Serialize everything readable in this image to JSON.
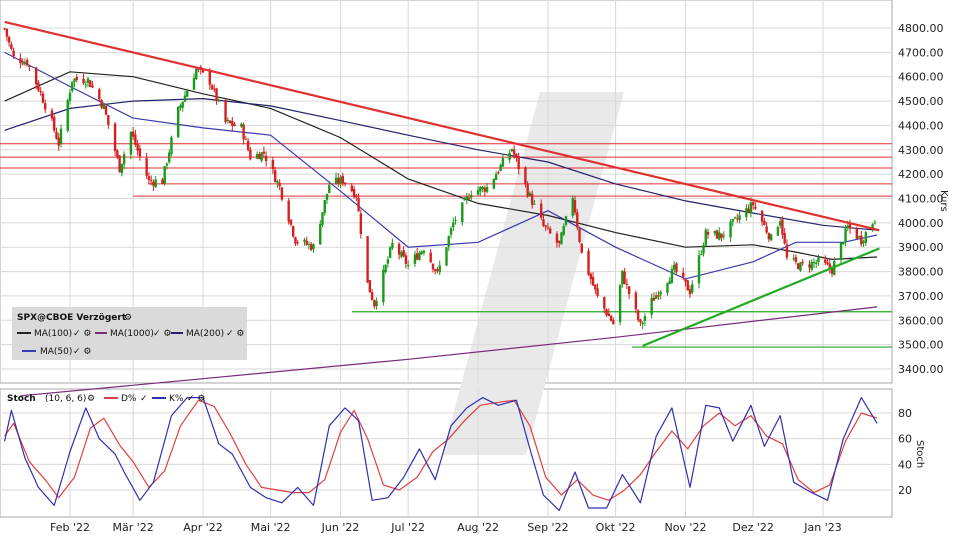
{
  "colors": {
    "candle_up": "#1a9a1a",
    "candle_down": "#d42020",
    "resistance": "#e03030",
    "support": "#22aa22",
    "ma100": "#222222",
    "ma1000": "#7a2a7a",
    "ma200": "#22226e",
    "ma50": "#3a3ab0",
    "stoch_d": "#e04040",
    "stoch_k": "#3030b0",
    "grid": "#d8d8d8"
  },
  "main_panel": {
    "axis_title": "Kurs",
    "legend": {
      "title": "SPX@CBOE Verzögert",
      "items": [
        {
          "label": "MA(100)",
          "color": "#222222"
        },
        {
          "label": "MA(1000)",
          "color": "#7a2a7a"
        },
        {
          "label": "MA(200)",
          "color": "#22226e"
        },
        {
          "label": "MA(50)",
          "color": "#3a3ab0"
        }
      ]
    }
  },
  "stoch_panel": {
    "axis_title": "Stoch",
    "legend": {
      "title": "Stoch",
      "params": "(10, 6, 6)",
      "d_label": "D%",
      "k_label": "K%"
    }
  },
  "chart_data": [
    {
      "type": "candlestick",
      "ylim": [
        3330,
        4900
      ],
      "yticks": [
        "3400.00",
        "3500.00",
        "3600.00",
        "3700.00",
        "3800.00",
        "3900.00",
        "4000.00",
        "4100.00",
        "4200.00",
        "4300.00",
        "4400.00",
        "4500.00",
        "4600.00",
        "4700.00",
        "4800.00"
      ],
      "xticks": [
        "Feb '22",
        "Mär '22",
        "Apr '22",
        "Mai '22",
        "Jun '22",
        "Jul '22",
        "Aug '22",
        "Sep '22",
        "Okt '22",
        "Nov '22",
        "Dez '22",
        "Jan '23"
      ],
      "ylabel": "Kurs",
      "grid": true,
      "close_path": [
        [
          "2022-01-03",
          4797
        ],
        [
          "2022-01-07",
          4677
        ],
        [
          "2022-01-13",
          4660
        ],
        [
          "2022-01-19",
          4532
        ],
        [
          "2022-01-24",
          4410
        ],
        [
          "2022-01-27",
          4326
        ],
        [
          "2022-02-02",
          4589
        ],
        [
          "2022-02-09",
          4587
        ],
        [
          "2022-02-16",
          4475
        ],
        [
          "2022-02-23",
          4225
        ],
        [
          "2022-02-28",
          4373
        ],
        [
          "2022-03-08",
          4170
        ],
        [
          "2022-03-14",
          4173
        ],
        [
          "2022-03-21",
          4461
        ],
        [
          "2022-03-29",
          4631
        ],
        [
          "2022-04-04",
          4582
        ],
        [
          "2022-04-11",
          4412
        ],
        [
          "2022-04-18",
          4391
        ],
        [
          "2022-04-22",
          4271
        ],
        [
          "2022-04-28",
          4287
        ],
        [
          "2022-05-05",
          4146
        ],
        [
          "2022-05-12",
          3930
        ],
        [
          "2022-05-20",
          3901
        ],
        [
          "2022-05-27",
          4158
        ],
        [
          "2022-06-02",
          4176
        ],
        [
          "2022-06-08",
          4115
        ],
        [
          "2022-06-13",
          3750
        ],
        [
          "2022-06-16",
          3667
        ],
        [
          "2022-06-24",
          3911
        ],
        [
          "2022-07-01",
          3825
        ],
        [
          "2022-07-08",
          3899
        ],
        [
          "2022-07-14",
          3790
        ],
        [
          "2022-07-21",
          3999
        ],
        [
          "2022-07-29",
          4130
        ],
        [
          "2022-08-05",
          4145
        ],
        [
          "2022-08-16",
          4305
        ],
        [
          "2022-08-23",
          4129
        ],
        [
          "2022-08-30",
          3986
        ],
        [
          "2022-09-06",
          3908
        ],
        [
          "2022-09-12",
          4110
        ],
        [
          "2022-09-16",
          3873
        ],
        [
          "2022-09-23",
          3693
        ],
        [
          "2022-09-30",
          3586
        ],
        [
          "2022-10-04",
          3791
        ],
        [
          "2022-10-12",
          3577
        ],
        [
          "2022-10-17",
          3678
        ],
        [
          "2022-10-27",
          3808
        ],
        [
          "2022-11-03",
          3720
        ],
        [
          "2022-11-10",
          3956
        ],
        [
          "2022-11-17",
          3947
        ],
        [
          "2022-11-25",
          4026
        ],
        [
          "2022-12-01",
          4076
        ],
        [
          "2022-12-09",
          3934
        ],
        [
          "2022-12-13",
          4019
        ],
        [
          "2022-12-16",
          3852
        ],
        [
          "2022-12-22",
          3822
        ],
        [
          "2022-12-30",
          3840
        ],
        [
          "2023-01-05",
          3808
        ],
        [
          "2023-01-12",
          3983
        ],
        [
          "2023-01-18",
          3929
        ],
        [
          "2023-01-24",
          4016
        ]
      ],
      "trendlines": [
        {
          "name": "resistance",
          "from": [
            "2022-01-03",
            4825
          ],
          "to": [
            "2023-01-26",
            3970
          ]
        },
        {
          "name": "support",
          "from": [
            "2022-10-13",
            3495
          ],
          "to": [
            "2023-01-26",
            3895
          ]
        }
      ],
      "horizontal_levels": {
        "resistance": [
          4325,
          4270,
          4225,
          4160,
          4110
        ],
        "support": [
          3635,
          3490
        ]
      },
      "moving_averages": {
        "MA(100)": [
          [
            "2022-01-03",
            4500
          ],
          [
            "2022-02-01",
            4620
          ],
          [
            "2022-03-01",
            4600
          ],
          [
            "2022-04-01",
            4530
          ],
          [
            "2022-05-01",
            4470
          ],
          [
            "2022-06-01",
            4350
          ],
          [
            "2022-07-01",
            4180
          ],
          [
            "2022-08-01",
            4080
          ],
          [
            "2022-09-01",
            4030
          ],
          [
            "2022-10-01",
            3960
          ],
          [
            "2022-11-01",
            3900
          ],
          [
            "2022-12-01",
            3910
          ],
          [
            "2022-12-20",
            3880
          ],
          [
            "2023-01-05",
            3850
          ],
          [
            "2023-01-25",
            3860
          ]
        ],
        "MA(200)": [
          [
            "2022-01-03",
            4380
          ],
          [
            "2022-02-01",
            4470
          ],
          [
            "2022-03-01",
            4500
          ],
          [
            "2022-04-01",
            4510
          ],
          [
            "2022-05-01",
            4480
          ],
          [
            "2022-06-01",
            4420
          ],
          [
            "2022-07-01",
            4360
          ],
          [
            "2022-08-01",
            4300
          ],
          [
            "2022-09-01",
            4250
          ],
          [
            "2022-10-01",
            4160
          ],
          [
            "2022-11-01",
            4090
          ],
          [
            "2022-12-01",
            4040
          ],
          [
            "2023-01-01",
            3990
          ],
          [
            "2023-01-25",
            3970
          ]
        ],
        "MA(50)": [
          [
            "2022-01-03",
            4700
          ],
          [
            "2022-02-01",
            4560
          ],
          [
            "2022-03-01",
            4430
          ],
          [
            "2022-04-01",
            4390
          ],
          [
            "2022-05-01",
            4360
          ],
          [
            "2022-06-01",
            4130
          ],
          [
            "2022-07-01",
            3900
          ],
          [
            "2022-08-01",
            3920
          ],
          [
            "2022-09-01",
            4050
          ],
          [
            "2022-10-01",
            3900
          ],
          [
            "2022-11-01",
            3770
          ],
          [
            "2022-12-01",
            3840
          ],
          [
            "2022-12-20",
            3920
          ],
          [
            "2023-01-10",
            3920
          ],
          [
            "2023-01-25",
            3950
          ]
        ],
        "MA(1000)": [
          [
            "2022-01-10",
            3290
          ],
          [
            "2022-04-01",
            3360
          ],
          [
            "2022-07-01",
            3440
          ],
          [
            "2022-10-01",
            3530
          ],
          [
            "2023-01-25",
            3655
          ]
        ]
      }
    },
    {
      "type": "line",
      "name": "Stoch (10, 6, 6)",
      "ylim": [
        0,
        100
      ],
      "yticks": [
        20,
        40,
        60,
        80
      ],
      "ylabel": "Stoch",
      "series": [
        {
          "name": "D%",
          "points": [
            [
              "2022-01-03",
              62
            ],
            [
              "2022-01-07",
              72
            ],
            [
              "2022-01-14",
              42
            ],
            [
              "2022-01-21",
              28
            ],
            [
              "2022-01-27",
              14
            ],
            [
              "2022-02-03",
              30
            ],
            [
              "2022-02-10",
              68
            ],
            [
              "2022-02-16",
              76
            ],
            [
              "2022-02-23",
              55
            ],
            [
              "2022-03-01",
              42
            ],
            [
              "2022-03-08",
              22
            ],
            [
              "2022-03-15",
              35
            ],
            [
              "2022-03-22",
              70
            ],
            [
              "2022-03-30",
              90
            ],
            [
              "2022-04-06",
              85
            ],
            [
              "2022-04-13",
              64
            ],
            [
              "2022-04-20",
              40
            ],
            [
              "2022-04-27",
              22
            ],
            [
              "2022-05-04",
              20
            ],
            [
              "2022-05-11",
              18
            ],
            [
              "2022-05-18",
              18
            ],
            [
              "2022-05-25",
              28
            ],
            [
              "2022-06-01",
              65
            ],
            [
              "2022-06-07",
              82
            ],
            [
              "2022-06-13",
              60
            ],
            [
              "2022-06-20",
              24
            ],
            [
              "2022-06-27",
              20
            ],
            [
              "2022-07-05",
              30
            ],
            [
              "2022-07-12",
              50
            ],
            [
              "2022-07-19",
              60
            ],
            [
              "2022-07-26",
              74
            ],
            [
              "2022-08-02",
              86
            ],
            [
              "2022-08-09",
              88
            ],
            [
              "2022-08-17",
              90
            ],
            [
              "2022-08-24",
              70
            ],
            [
              "2022-08-31",
              30
            ],
            [
              "2022-09-07",
              16
            ],
            [
              "2022-09-14",
              28
            ],
            [
              "2022-09-21",
              16
            ],
            [
              "2022-09-28",
              12
            ],
            [
              "2022-10-05",
              20
            ],
            [
              "2022-10-12",
              32
            ],
            [
              "2022-10-19",
              50
            ],
            [
              "2022-10-26",
              66
            ],
            [
              "2022-11-02",
              52
            ],
            [
              "2022-11-09",
              70
            ],
            [
              "2022-11-16",
              80
            ],
            [
              "2022-11-23",
              70
            ],
            [
              "2022-11-30",
              78
            ],
            [
              "2022-12-07",
              62
            ],
            [
              "2022-12-14",
              56
            ],
            [
              "2022-12-21",
              28
            ],
            [
              "2022-12-28",
              18
            ],
            [
              "2023-01-04",
              24
            ],
            [
              "2023-01-11",
              58
            ],
            [
              "2023-01-18",
              80
            ],
            [
              "2023-01-25",
              76
            ]
          ]
        },
        {
          "name": "K%",
          "points": [
            [
              "2022-01-03",
              58
            ],
            [
              "2022-01-06",
              82
            ],
            [
              "2022-01-12",
              45
            ],
            [
              "2022-01-18",
              22
            ],
            [
              "2022-01-25",
              8
            ],
            [
              "2022-02-01",
              50
            ],
            [
              "2022-02-08",
              84
            ],
            [
              "2022-02-14",
              60
            ],
            [
              "2022-02-21",
              48
            ],
            [
              "2022-02-25",
              34
            ],
            [
              "2022-03-04",
              12
            ],
            [
              "2022-03-10",
              26
            ],
            [
              "2022-03-18",
              78
            ],
            [
              "2022-03-25",
              92
            ],
            [
              "2022-04-01",
              92
            ],
            [
              "2022-04-08",
              56
            ],
            [
              "2022-04-14",
              48
            ],
            [
              "2022-04-22",
              22
            ],
            [
              "2022-04-29",
              14
            ],
            [
              "2022-05-06",
              10
            ],
            [
              "2022-05-13",
              22
            ],
            [
              "2022-05-20",
              8
            ],
            [
              "2022-05-27",
              70
            ],
            [
              "2022-06-03",
              84
            ],
            [
              "2022-06-09",
              74
            ],
            [
              "2022-06-15",
              12
            ],
            [
              "2022-06-22",
              14
            ],
            [
              "2022-06-29",
              30
            ],
            [
              "2022-07-06",
              52
            ],
            [
              "2022-07-13",
              28
            ],
            [
              "2022-07-20",
              70
            ],
            [
              "2022-07-27",
              84
            ],
            [
              "2022-08-03",
              92
            ],
            [
              "2022-08-10",
              86
            ],
            [
              "2022-08-18",
              90
            ],
            [
              "2022-08-24",
              52
            ],
            [
              "2022-08-30",
              16
            ],
            [
              "2022-09-06",
              4
            ],
            [
              "2022-09-13",
              34
            ],
            [
              "2022-09-19",
              6
            ],
            [
              "2022-09-27",
              6
            ],
            [
              "2022-10-04",
              32
            ],
            [
              "2022-10-12",
              10
            ],
            [
              "2022-10-19",
              62
            ],
            [
              "2022-10-26",
              84
            ],
            [
              "2022-11-03",
              22
            ],
            [
              "2022-11-10",
              86
            ],
            [
              "2022-11-16",
              84
            ],
            [
              "2022-11-22",
              58
            ],
            [
              "2022-11-30",
              86
            ],
            [
              "2022-12-06",
              54
            ],
            [
              "2022-12-13",
              78
            ],
            [
              "2022-12-19",
              26
            ],
            [
              "2022-12-27",
              18
            ],
            [
              "2023-01-03",
              12
            ],
            [
              "2023-01-10",
              60
            ],
            [
              "2023-01-18",
              92
            ],
            [
              "2023-01-25",
              72
            ]
          ]
        }
      ]
    }
  ]
}
